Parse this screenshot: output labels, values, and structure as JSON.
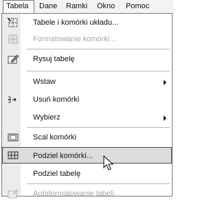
{
  "menubar": {
    "items": [
      {
        "label": "Tabela",
        "name": "menu-tabela"
      },
      {
        "label": "Dane",
        "name": "menu-dane"
      },
      {
        "label": "Ramki",
        "name": "menu-ramki"
      },
      {
        "label": "Okno",
        "name": "menu-okno"
      },
      {
        "label": "Pomoc",
        "name": "menu-pomoc"
      }
    ]
  },
  "menu": {
    "items": [
      {
        "label": "Tabele i komórki układu...",
        "icon": "layout-table-icon",
        "enabled": true
      },
      {
        "label": "Formatowanie komórki...",
        "icon": "format-cell-icon",
        "enabled": false
      },
      {
        "label": "Rysuj tabelę",
        "icon": "draw-table-pencil-icon",
        "enabled": true
      },
      {
        "label": "Wstaw",
        "icon": null,
        "enabled": true,
        "submenu": true
      },
      {
        "label": "Usuń komórki",
        "icon": "delete-cells-icon",
        "enabled": true
      },
      {
        "label": "Wybierz",
        "icon": null,
        "enabled": true,
        "submenu": true
      },
      {
        "label": "Scal komórki",
        "icon": "merge-cells-icon",
        "enabled": true
      },
      {
        "label": "Podziel komórki...",
        "icon": "split-cells-icon",
        "enabled": true,
        "highlighted": true
      },
      {
        "label": "Podziel tabelę",
        "icon": null,
        "enabled": true
      },
      {
        "label": "Autoformatowanie tabeli",
        "icon": "autoformat-table-icon",
        "enabled": false
      }
    ]
  }
}
